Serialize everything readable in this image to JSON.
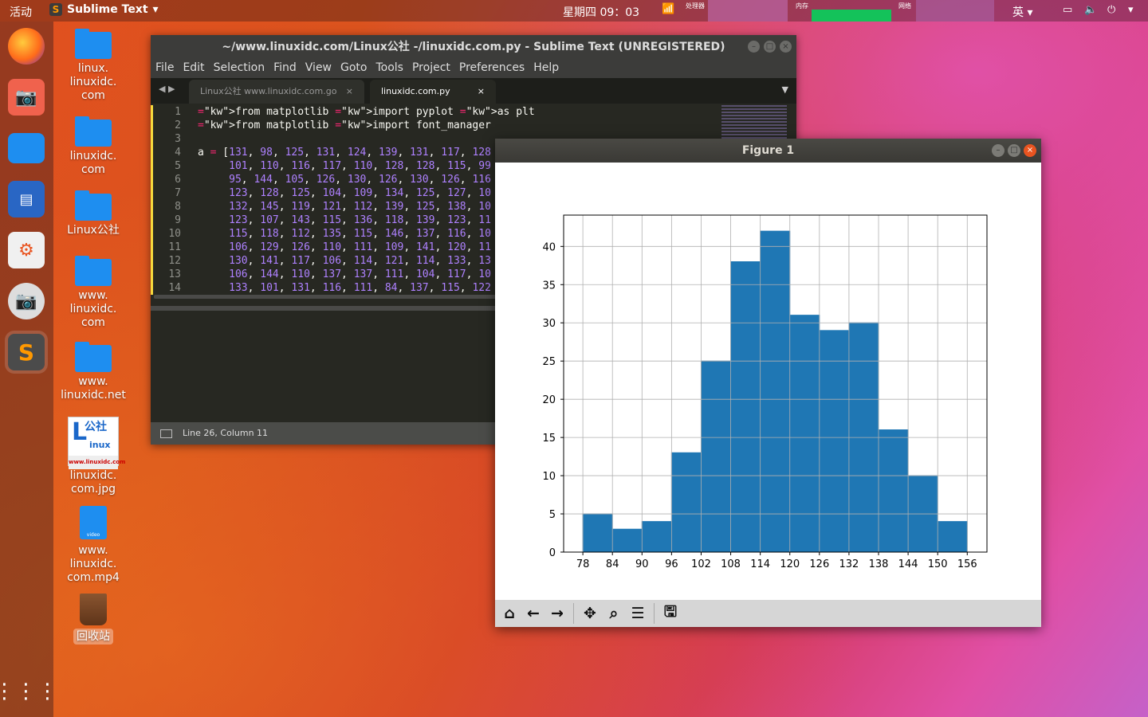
{
  "topbar": {
    "activities": "活动",
    "app_name": "Sublime Text",
    "app_arrow": "▾",
    "clock": "星期四 09：03",
    "cpu_label": "处理器",
    "mem_label": "内存",
    "net_label": "网络",
    "lang": "英",
    "lang_arrow": "▾",
    "tray_arrow": "▾"
  },
  "desktop": [
    {
      "label": "linux.\nlinuxidc.\ncom",
      "kind": "folder"
    },
    {
      "label": "linuxidc.\ncom",
      "kind": "folder"
    },
    {
      "label": "Linux公社",
      "kind": "folder"
    },
    {
      "label": "www.\nlinuxidc.\ncom",
      "kind": "folder"
    },
    {
      "label": "www.\nlinuxidc.net",
      "kind": "folder"
    },
    {
      "label": "linuxidc.\ncom.jpg",
      "kind": "image",
      "thumb_big": "公社",
      "thumb_small": "inux",
      "thumb_url": "www.linuxidc.com"
    },
    {
      "label": "www.\nlinuxidc.\ncom.mp4",
      "kind": "video",
      "thumb_text": "video"
    },
    {
      "label": "回收站",
      "kind": "trash"
    }
  ],
  "sublime": {
    "title": "~/www.linuxidc.com/Linux公社 -/linuxidc.com.py - Sublime Text (UNREGISTERED)",
    "menu": [
      "File",
      "Edit",
      "Selection",
      "Find",
      "View",
      "Goto",
      "Tools",
      "Project",
      "Preferences",
      "Help"
    ],
    "tabs": [
      {
        "label": "Linux公社 www.linuxidc.com.go",
        "close": "×"
      },
      {
        "label": "linuxidc.com.py",
        "close": "×"
      }
    ],
    "code": [
      [
        "1",
        "from matplotlib import pyplot as plt"
      ],
      [
        "2",
        "from matplotlib import font_manager"
      ],
      [
        "3",
        ""
      ],
      [
        "4",
        "a = [131, 98, 125, 131, 124, 139, 131, 117, 128"
      ],
      [
        "5",
        "     101, 110, 116, 117, 110, 128, 128, 115, 99"
      ],
      [
        "6",
        "     95, 144, 105, 126, 130, 126, 130, 126, 116"
      ],
      [
        "7",
        "     123, 128, 125, 104, 109, 134, 125, 127, 10"
      ],
      [
        "8",
        "     132, 145, 119, 121, 112, 139, 125, 138, 10"
      ],
      [
        "9",
        "     123, 107, 143, 115, 136, 118, 139, 123, 11"
      ],
      [
        "10",
        "     115, 118, 112, 135, 115, 146, 137, 116, 10"
      ],
      [
        "11",
        "     106, 129, 126, 110, 111, 109, 141, 120, 11"
      ],
      [
        "12",
        "     130, 141, 117, 106, 114, 121, 114, 133, 13"
      ],
      [
        "13",
        "     106, 144, 110, 137, 137, 111, 104, 117, 10"
      ],
      [
        "14",
        "     133, 101, 131, 116, 111, 84, 137, 115, 122"
      ]
    ],
    "status": "Line 26, Column 11"
  },
  "figure": {
    "title": "Figure 1",
    "toolbar": [
      "home-icon",
      "back-icon",
      "forward-icon",
      "pan-icon",
      "zoom-icon",
      "configure-icon",
      "save-icon"
    ]
  },
  "chart_data": {
    "type": "bar",
    "title": "",
    "xlabel": "",
    "ylabel": "",
    "bin_edges": [
      78,
      84,
      90,
      96,
      102,
      108,
      114,
      120,
      126,
      132,
      138,
      144,
      150,
      156
    ],
    "values": [
      5,
      3,
      4,
      13,
      25,
      38,
      42,
      31,
      29,
      30,
      16,
      10,
      4
    ],
    "xticks": [
      78,
      84,
      90,
      96,
      102,
      108,
      114,
      120,
      126,
      132,
      138,
      144,
      150,
      156
    ],
    "yticks": [
      0,
      5,
      10,
      15,
      20,
      25,
      30,
      35,
      40
    ],
    "xlim": [
      74.1,
      160
    ],
    "ylim": [
      0,
      44.1
    ],
    "grid": true,
    "bar_color": "#1f77b4"
  }
}
